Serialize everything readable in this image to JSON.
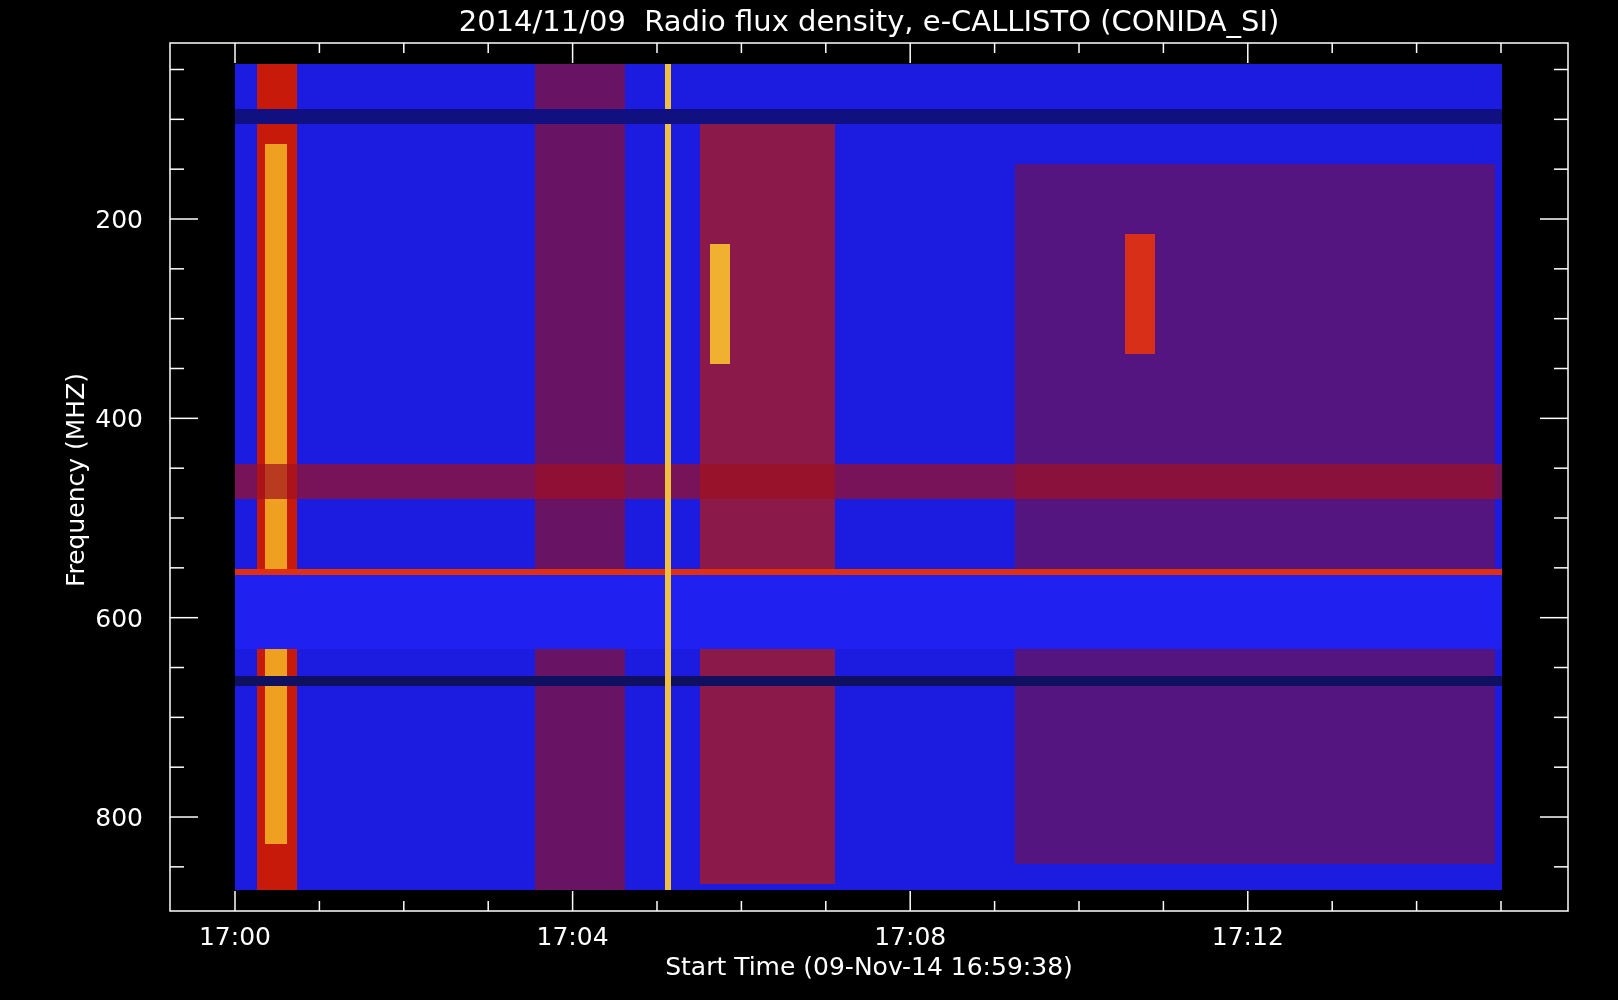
{
  "title": "2014/11/09  Radio flux density, e-CALLISTO (CONIDA_SI)",
  "xlabel": "Start Time (09-Nov-14 16:59:38)",
  "ylabel": "Frequency (MHZ)",
  "xtick_labels": [
    "17:00",
    "17:04",
    "17:08",
    "17:12"
  ],
  "ytick_labels": [
    "200",
    "400",
    "600",
    "800"
  ]
}
